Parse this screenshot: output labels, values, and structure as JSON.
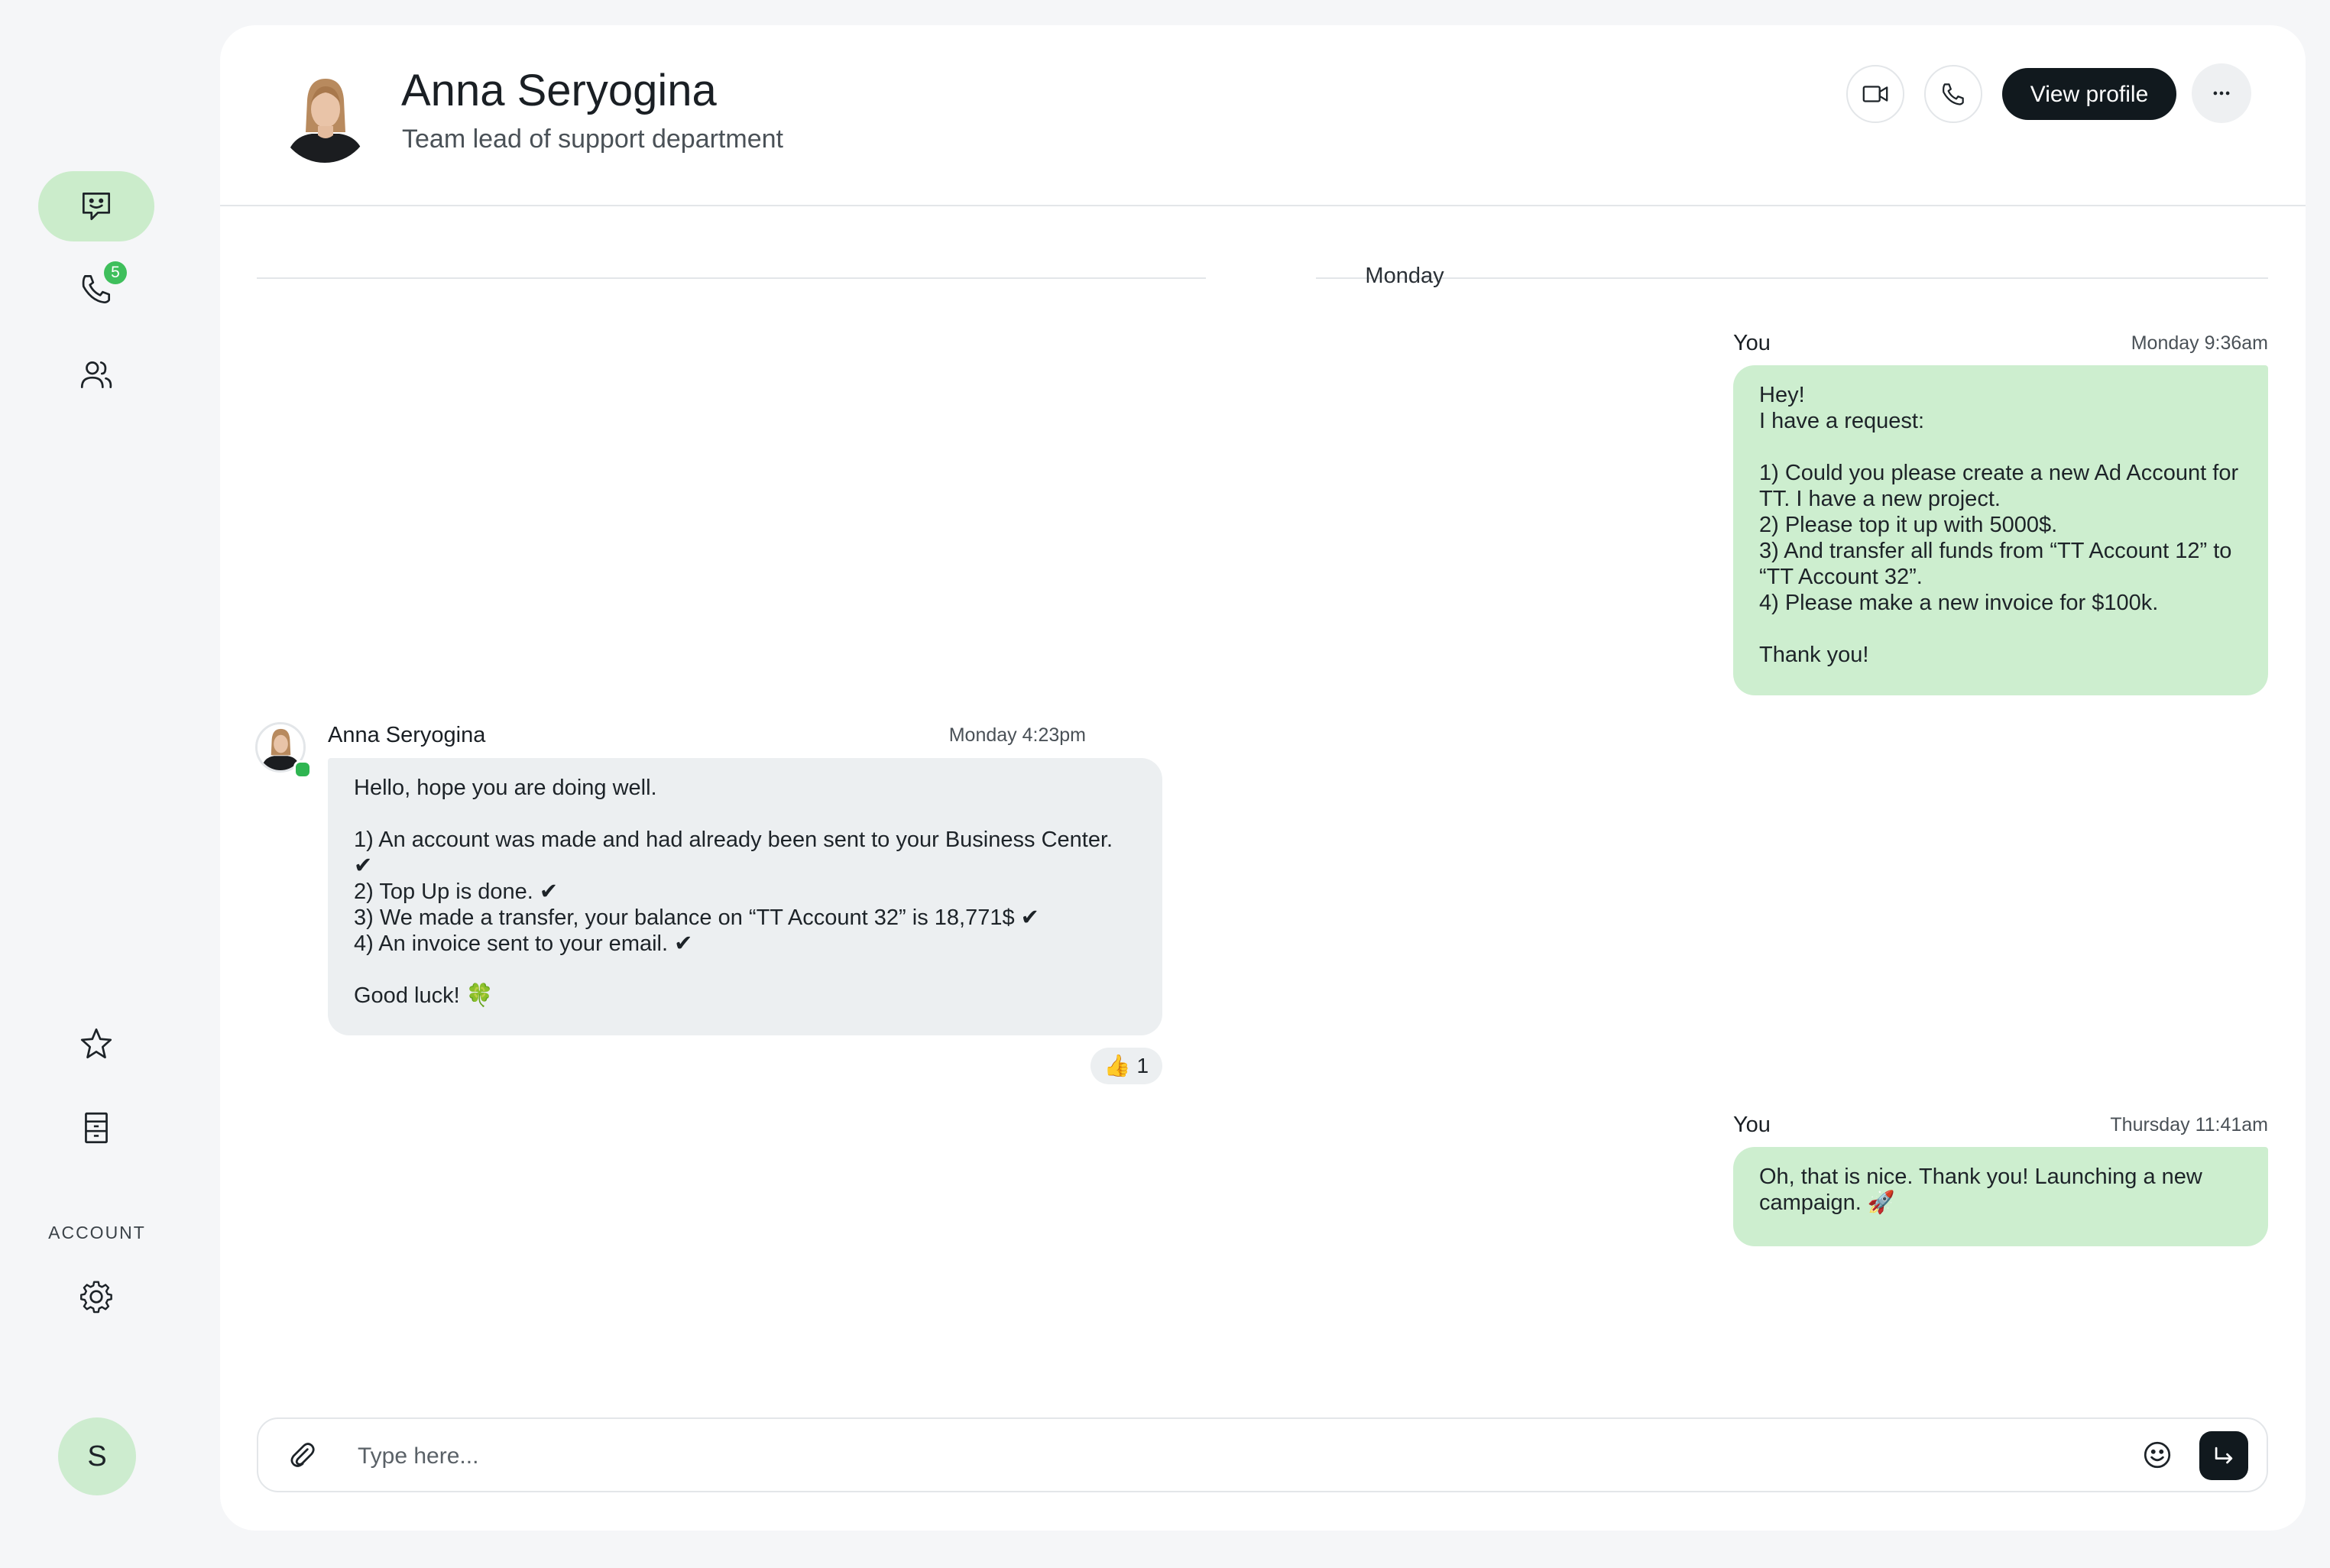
{
  "sidebar": {
    "calls_badge": "5",
    "section_label": "ACCOUNT",
    "user_initial": "S"
  },
  "header": {
    "contact_name": "Anna Seryogina",
    "contact_role": "Team lead of support department",
    "view_profile_label": "View profile"
  },
  "chat": {
    "day_separator": "Monday",
    "messages": [
      {
        "sender": "You",
        "time": "Monday 9:36am",
        "text": "Hey!\nI have a request:\n\n1) Could you please create a new Ad Account for TT. I have a new project.\n2) Please top it up with 5000$.\n3) And transfer all funds from “TT Account 12” to “TT Account 32”.\n4) Please make a new invoice for $100k.\n\nThank you!"
      },
      {
        "sender": "Anna Seryogina",
        "time": "Monday 4:23pm",
        "text": "Hello, hope you are doing well.\n\n1) An account was made and had already been sent to your Business Center. ✔\n2) Top Up is done. ✔\n3) We made a transfer, your balance on “TT Account 32” is 18,771$ ✔\n4) An invoice sent to your email. ✔\n\nGood luck! 🍀",
        "reaction": "👍 1"
      },
      {
        "sender": "You",
        "time": "Thursday 11:41am",
        "text": "Oh, that is nice. Thank you! Launching a new campaign. 🚀"
      }
    ]
  },
  "composer": {
    "placeholder": "Type here..."
  },
  "colors": {
    "accent_green": "#cbeccb",
    "outgoing_bubble": "#cdeecf",
    "incoming_bubble": "#eceff1",
    "dark_button": "#11191e",
    "badge_green": "#3fbf5c",
    "online_dot": "#2fb551"
  }
}
